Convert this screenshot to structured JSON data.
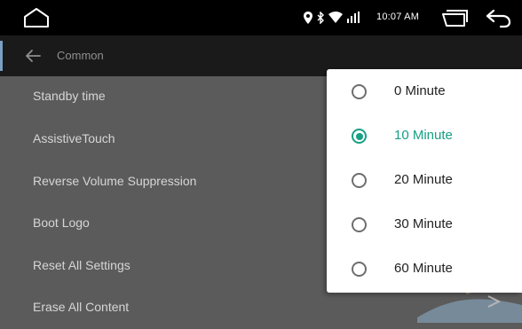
{
  "status_bar": {
    "time": "10:07 AM",
    "icons": [
      "home-icon",
      "location-icon",
      "bluetooth-icon",
      "wifi-icon",
      "signal-icon",
      "recents-icon",
      "back-icon"
    ]
  },
  "header": {
    "title": "Common"
  },
  "settings": {
    "items": [
      {
        "label": "Standby time"
      },
      {
        "label": "AssistiveTouch"
      },
      {
        "label": "Reverse Volume Suppression"
      },
      {
        "label": "Boot Logo"
      },
      {
        "label": "Reset All Settings"
      },
      {
        "label": "Erase All Content"
      }
    ]
  },
  "popup": {
    "selected_index": 1,
    "options": [
      {
        "label": "0 Minute"
      },
      {
        "label": "10 Minute"
      },
      {
        "label": "20 Minute"
      },
      {
        "label": "30 Minute"
      },
      {
        "label": "60 Minute"
      }
    ]
  },
  "colors": {
    "accent": "#16a085",
    "overlay": "#5b5b5b",
    "statusbar": "#000000"
  }
}
